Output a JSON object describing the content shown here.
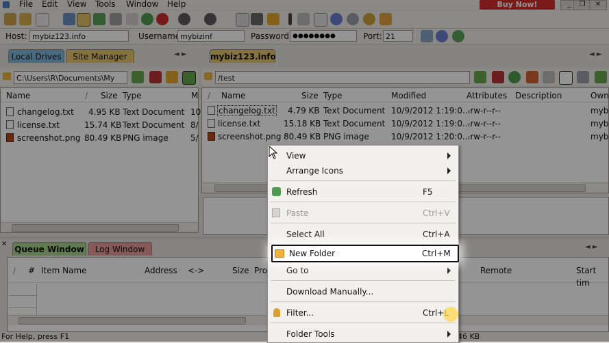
{
  "menu": [
    "File",
    "Edit",
    "View",
    "Tools",
    "Window",
    "Help"
  ],
  "buy_now": "Buy Now!",
  "window_controls": [
    "_",
    "❐",
    "✕"
  ],
  "connection": {
    "host_label": "Host:",
    "host_value": "mybiz123.info",
    "username_label": "Username:",
    "username_value": "mybizinf",
    "password_label": "Password:",
    "password_value": "●●●●●●●●",
    "port_label": "Port:",
    "port_value": "21"
  },
  "left_tabs": [
    "Local Drives",
    "Site Manager"
  ],
  "right_tab": "mybiz123.info",
  "left_path": "C:\\Users\\R\\Documents\\My",
  "right_path": "/test",
  "local_columns": [
    "Name",
    "Size",
    "Type",
    "M"
  ],
  "local_files": [
    {
      "name": "changelog.txt",
      "size": "4.95 KB",
      "type": "Text Document",
      "m": "10"
    },
    {
      "name": "license.txt",
      "size": "15.74 KB",
      "type": "Text Document",
      "m": "8/"
    },
    {
      "name": "screenshot.png",
      "size": "80.49 KB",
      "type": "PNG image",
      "m": "5/"
    }
  ],
  "remote_columns": [
    "Name",
    "Size",
    "Type",
    "Modified",
    "Attributes",
    "Description",
    "Owne"
  ],
  "remote_files": [
    {
      "name": "changelog.txt",
      "size": "4.79 KB",
      "type": "Text Document",
      "modified": "10/9/2012 1:19:0...",
      "attributes": "-rw-r--r--",
      "owner": "mybi"
    },
    {
      "name": "license.txt",
      "size": "15.18 KB",
      "type": "Text Document",
      "modified": "10/9/2012 1:19:0...",
      "attributes": "-rw-r--r--",
      "owner": "mybi"
    },
    {
      "name": "screenshot.png",
      "size": "80.49 KB",
      "type": "PNG image",
      "modified": "10/9/2012 1:20:0...",
      "attributes": "-rw-r--r--",
      "owner": "mybi"
    }
  ],
  "queue_tabs": [
    "Queue Window",
    "Log Window"
  ],
  "queue_columns": [
    "#",
    "Item Name",
    "Address",
    "<->",
    "Size",
    "Pro",
    "Remote",
    "Start tim"
  ],
  "context_menu": [
    {
      "label": "View",
      "shortcut": "",
      "submenu": true,
      "disabled": false
    },
    {
      "label": "Arrange Icons",
      "shortcut": "",
      "submenu": true,
      "disabled": false
    },
    {
      "label": "Refresh",
      "shortcut": "F5",
      "submenu": false,
      "disabled": false
    },
    {
      "label": "Paste",
      "shortcut": "Ctrl+V",
      "submenu": false,
      "disabled": true
    },
    {
      "label": "Select All",
      "shortcut": "Ctrl+A",
      "submenu": false,
      "disabled": false
    },
    {
      "label": "New Folder",
      "shortcut": "Ctrl+M",
      "submenu": false,
      "disabled": false
    },
    {
      "label": "Go to",
      "shortcut": "",
      "submenu": true,
      "disabled": false
    },
    {
      "label": "Download Manually...",
      "shortcut": "",
      "submenu": false,
      "disabled": false
    },
    {
      "label": "Filter...",
      "shortcut": "Ctrl+L",
      "submenu": false,
      "disabled": false
    },
    {
      "label": "Folder Tools",
      "shortcut": "",
      "submenu": true,
      "disabled": false
    }
  ],
  "status_text": "For Help, press F1",
  "status_right": "46 KB",
  "colors": {
    "buy_now": "#d62d2d",
    "local_tab": "#7fb8e0",
    "site_tab": "#e8c66a",
    "remote_tab": "#e8c66a",
    "log_tab": "#e89a9a",
    "queue_tab": "#a8d48a"
  }
}
